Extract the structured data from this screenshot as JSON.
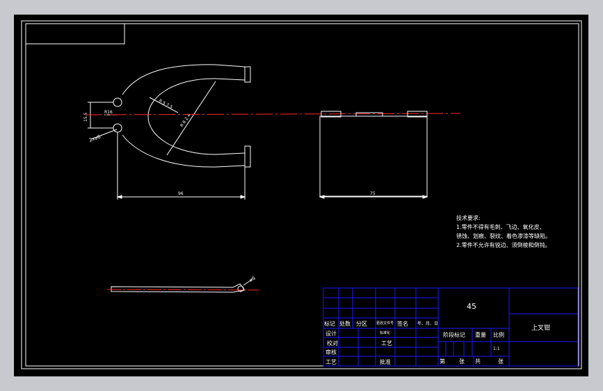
{
  "drawing": {
    "background": "#000000",
    "frame_color": "#ffffff",
    "part_color": "#ffffff",
    "centerline_color": "#ff2a2a",
    "table_color": "#1a1aff"
  },
  "views": {
    "front": {
      "dim_radius_top": "R16",
      "dim_radius_mid": "R 5 7.5",
      "dim_left_vertical": "15.5",
      "dim_small_hole": "2x⌀6",
      "dim_long": "R 8 2 4",
      "dim_width": "96"
    },
    "side": {
      "dim_width": "75"
    },
    "section": {
      "dim_tag": "⌀6"
    }
  },
  "notes": {
    "heading": "技术要求:",
    "line1": "1.零件不得有毛刺、飞边、氧化皮、",
    "line2": "锈蚀、划痕、裂纹、着色渗漆等缺陷。",
    "line3": "2.零件不允许有锐边、须倒棱和倒钝。"
  },
  "title_block": {
    "material": "45",
    "part_name": "上叉钳",
    "row_header": [
      "标记",
      "处数",
      "分区",
      "更改文件号",
      "签名",
      "年、月、日"
    ],
    "design": "设计",
    "standardize": "标准化",
    "check": "校对",
    "craft_check": "工艺",
    "review": "审核",
    "process": "工艺",
    "approve": "批准",
    "stage_mark": "阶段标记",
    "weight": "重量",
    "scale": "比例",
    "scale_value": "1:1",
    "sheet_total": "共",
    "sheet_total_unit": "张",
    "sheet_no": "第",
    "sheet_no_unit": "张"
  }
}
